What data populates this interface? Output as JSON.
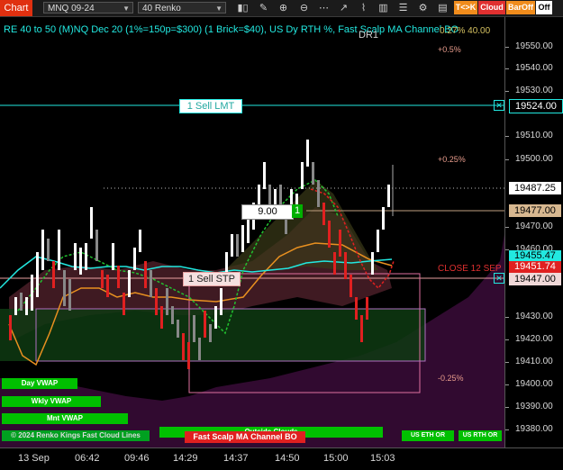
{
  "toolbar": {
    "chart_label": "Chart",
    "instrument": "MNQ 09-24",
    "bar_type": "40 Renko",
    "tk_label": "T<>K",
    "cloud_label": "Cloud",
    "baroff_label": "BarOff",
    "off_label": "Off",
    "icons": [
      "bar-style-icon",
      "draw-icon",
      "zoom-in-icon",
      "zoom-out-icon",
      "dots-icon",
      "trend-icon",
      "brush-icon",
      "chart-props-icon",
      "align-icon",
      "strategy-icon",
      "template-icon"
    ]
  },
  "chart": {
    "title": "RE 40 to 50 (M)NQ Dec 20 (1%=150p=$300) (1 Brick=$40), US Dy RTH %, Fast Scalp MA Channel BO",
    "dr1": "DR1",
    "pct_top": "+0.5%",
    "pct_mid": "+0.25%",
    "pct_low": "-0.25%",
    "target_text": "0.27% 40.00",
    "close_label": "CLOSE 12 SEP",
    "sell_lmt": "1 Sell LMT",
    "sell_stp": "1 Sell STP",
    "position_qty": "9.00",
    "position_side": "1",
    "day_vwap": "Day VWAP",
    "wkly_vwap": "Wkly VWAP",
    "mnt_vwap": "Mnt VWAP",
    "outside_clouds": "Outside Clouds",
    "copyright": "© 2024 Renko Kings Fast Cloud Lines",
    "strategy_label": "Fast Scalp MA Channel BO",
    "us_eth": "US ETH OR",
    "us_rth": "US RTH OR"
  },
  "y_axis": {
    "ticks": [
      "19550.00",
      "19540.00",
      "19530.00",
      "19510.00",
      "19500.00",
      "19470.00",
      "19460.00",
      "19430.00",
      "19420.00",
      "19410.00",
      "19400.00",
      "19390.00",
      "19380.00"
    ],
    "highlights": {
      "sell_lmt": "19524.00",
      "last": "19487.25",
      "position": "19477.00",
      "cyan": "19455.47",
      "red": "19451.74",
      "sell_stp": "19447.00"
    }
  },
  "x_axis": {
    "labels": [
      "13 Sep",
      "06:42",
      "09:46",
      "14:29",
      "14:37",
      "14:50",
      "15:00",
      "15:03"
    ]
  },
  "colors": {
    "cyan": "#22e8e0",
    "red": "#e02020",
    "white": "#ffffff",
    "green": "#00c000"
  }
}
